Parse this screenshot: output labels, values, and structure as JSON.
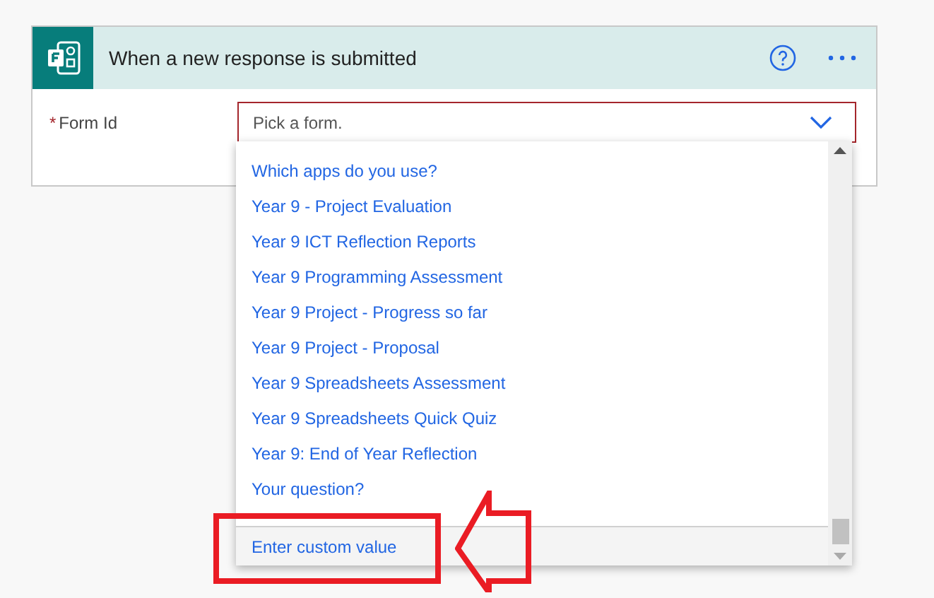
{
  "card": {
    "title": "When a new response is submitted"
  },
  "field": {
    "label": "Form Id",
    "required_mark": "*",
    "required": true,
    "placeholder": "Pick a form."
  },
  "dropdown": {
    "options": [
      {
        "label": "Which apps do you use?"
      },
      {
        "label": "Year 9 - Project Evaluation"
      },
      {
        "label": "Year 9 ICT Reflection Reports"
      },
      {
        "label": "Year 9 Programming Assessment"
      },
      {
        "label": "Year 9 Project - Progress so far"
      },
      {
        "label": "Year 9 Project - Proposal"
      },
      {
        "label": "Year 9 Spreadsheets Assessment"
      },
      {
        "label": "Year 9 Spreadsheets Quick Quiz"
      },
      {
        "label": "Year 9: End of Year Reflection"
      },
      {
        "label": "Your question?"
      }
    ],
    "footer": "Enter custom value"
  }
}
